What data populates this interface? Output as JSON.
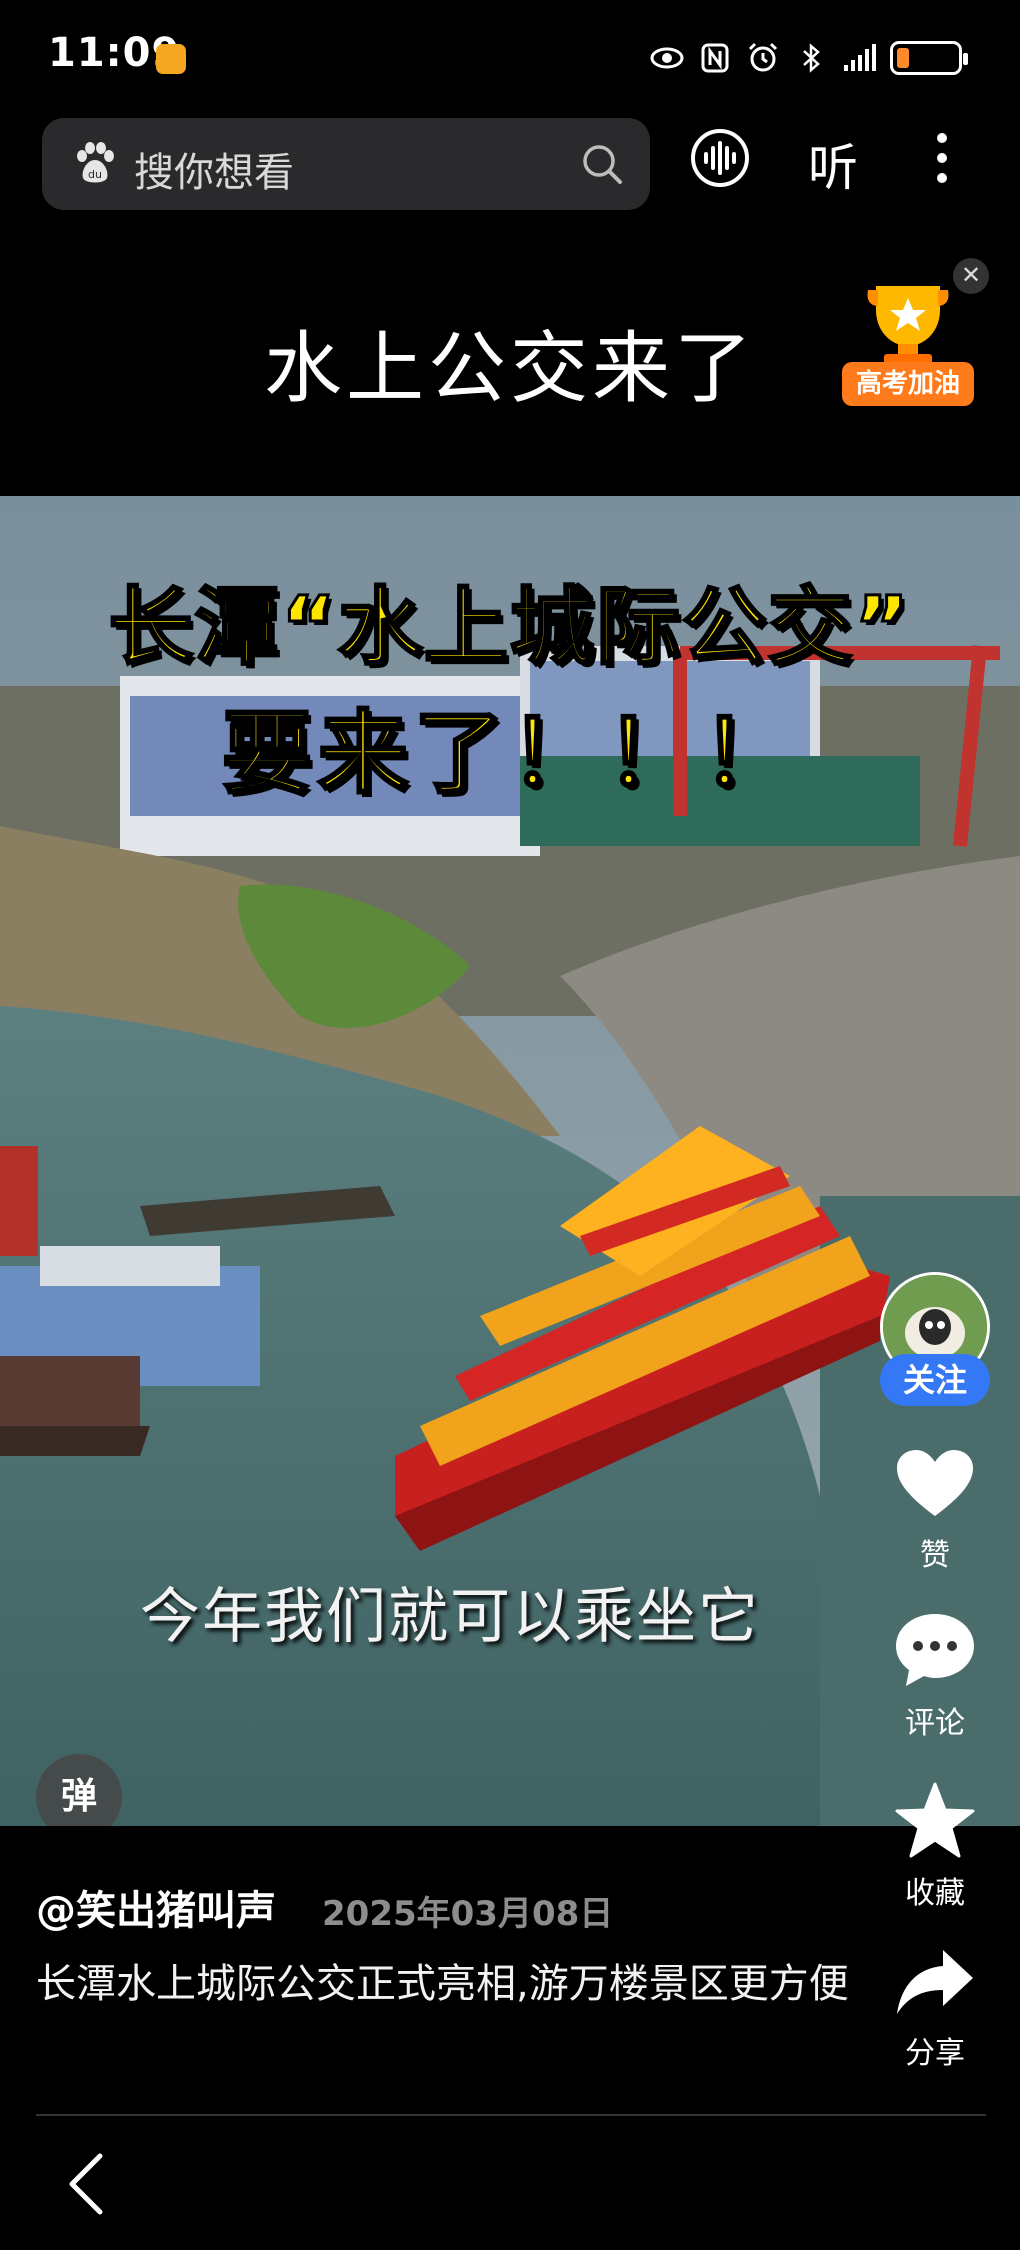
{
  "status_bar": {
    "time": "11:09",
    "battery_level": 0.2
  },
  "search": {
    "placeholder": "搜你想看"
  },
  "toolbar": {
    "listen_label": "听"
  },
  "header": {
    "title": "水上公交来了",
    "badge_label": "高考加油"
  },
  "video": {
    "headline_line1": "长潭“水上城际公交”",
    "headline_line2": "要来了！！！",
    "subtitle": "今年我们就可以乘坐它",
    "danmu_label": "弹"
  },
  "rail": {
    "follow_label": "关注",
    "like_label": "赞",
    "comment_label": "评论",
    "favorite_label": "收藏",
    "share_label": "分享"
  },
  "post": {
    "author": "@笑出猪叫声",
    "date": "2025年03月08日",
    "description": "长潭水上城际公交正式亮相,游万楼景区更方便"
  },
  "colors": {
    "accent_blue": "#3478f6",
    "headline_yellow": "#ffe600",
    "badge_orange": "#ff7a1a"
  }
}
